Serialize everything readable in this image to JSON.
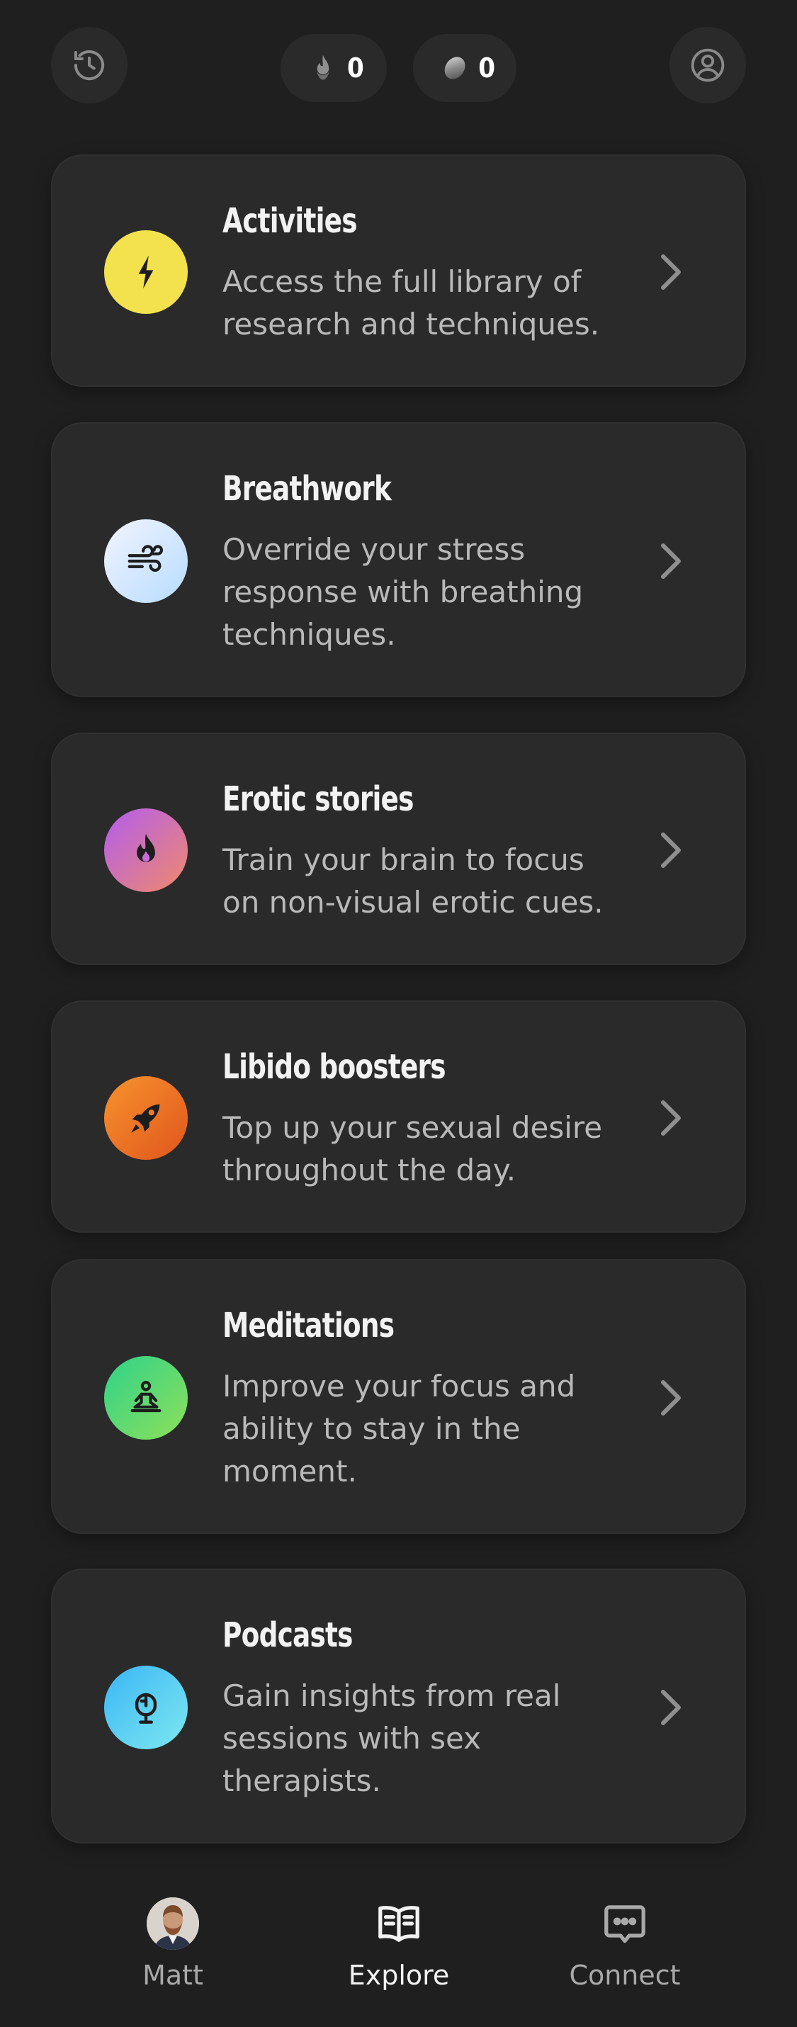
{
  "header": {
    "streak_count": "0",
    "coin_count": "0"
  },
  "cards": [
    {
      "title": "Activities",
      "description": "Access the full library of research and techniques.",
      "icon": "lightning-icon",
      "color": "#f5e04c"
    },
    {
      "title": "Breathwork",
      "description": "Override your stress response with breathing techniques.",
      "icon": "wind-icon",
      "color": "#cfe6ff"
    },
    {
      "title": "Erotic stories",
      "description": "Train your brain to focus on non-visual erotic cues.",
      "icon": "flame-icon",
      "color": "#c86ad8"
    },
    {
      "title": "Libido boosters",
      "description": "Top up your sexual desire throughout the day.",
      "icon": "rocket-icon",
      "color": "#f07a2a"
    },
    {
      "title": "Meditations",
      "description": "Improve your focus and ability to stay in the moment.",
      "icon": "meditation-icon",
      "color": "#3fd672"
    },
    {
      "title": "Podcasts",
      "description": "Gain insights from real sessions with sex therapists.",
      "icon": "microphone-icon",
      "color": "#4cc8f0"
    }
  ],
  "nav": {
    "me_label": "Matt",
    "explore_label": "Explore",
    "connect_label": "Connect",
    "active": "Explore"
  }
}
